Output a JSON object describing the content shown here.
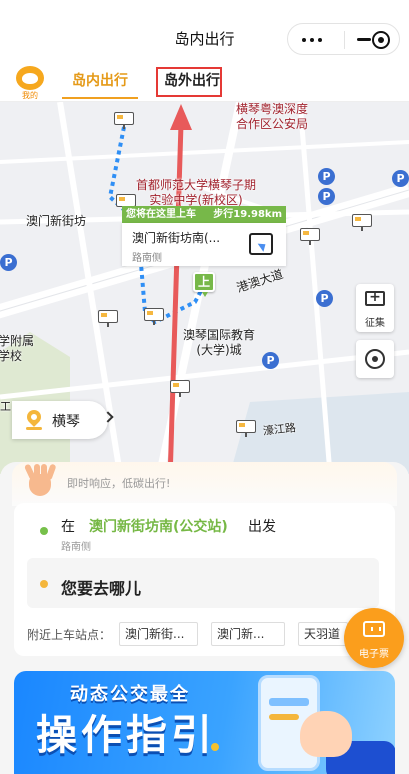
{
  "window": {
    "title": "岛内出行"
  },
  "header": {
    "avatar_label": "我的",
    "tabs": [
      {
        "label": "岛内出行",
        "active": true
      },
      {
        "label": "岛外出行",
        "active": false
      }
    ],
    "accent_color": "#e59a18",
    "highlight_box_color": "#e53935"
  },
  "map": {
    "labels": {
      "police": [
        "横琴粤澳深度",
        "合作区公安局"
      ],
      "school": [
        "首都师范大学横琴子期",
        "实验中学(新校区)"
      ],
      "macau_street": "澳门新街坊",
      "road_gangao": "港澳大道",
      "edu_city": [
        "澳琴国际教育",
        "(大学)城"
      ],
      "school_left": [
        "学附属",
        "学校"
      ],
      "road_haojiang": "濠江路",
      "left_edge": "工"
    },
    "popup": {
      "header": "您将在这里上车",
      "walk": "步行19.98km",
      "station": "澳门新街坊南(...",
      "side": "路南侧"
    },
    "station_marker": "上",
    "collect_label": "征集",
    "city": "横琴",
    "parking_symbol": "P"
  },
  "panel": {
    "slogan": "即时响应，低碳出行!",
    "from_prefix": "在",
    "from_station": "澳门新街坊南(公交站)",
    "from_suffix": "出发",
    "from_side": "路南侧",
    "destination_placeholder": "您要去哪儿",
    "nearby_label": "附近上车站点：",
    "nearby_stops": [
      "澳门新街...",
      "澳门新...",
      "天羽道"
    ],
    "eticket_label": "电子票",
    "start_dot_color": "#76c04a",
    "end_dot_color": "#f4b63c"
  },
  "banner": {
    "line1": "动态公交最全",
    "line2": "操作指引"
  }
}
